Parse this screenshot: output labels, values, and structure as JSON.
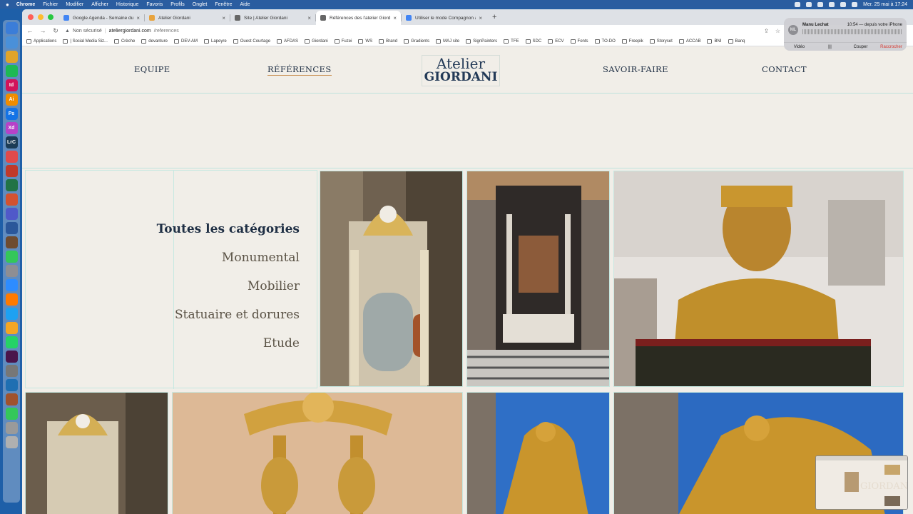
{
  "menubar": {
    "app": "Chrome",
    "menus": [
      "Fichier",
      "Modifier",
      "Afficher",
      "Historique",
      "Favoris",
      "Profils",
      "Onglet",
      "Fenêtre",
      "Aide"
    ],
    "clock": "Mer. 25 mai à 17:24"
  },
  "dock": {
    "apps": [
      {
        "label": "",
        "color": "#3b7dd8"
      },
      {
        "label": "",
        "color": "#4a90d9"
      },
      {
        "label": "",
        "color": "#e0a42a"
      },
      {
        "label": "",
        "color": "#1db954"
      },
      {
        "label": "Id",
        "color": "#d1145a"
      },
      {
        "label": "Ai",
        "color": "#f08c00"
      },
      {
        "label": "Ps",
        "color": "#1473e6"
      },
      {
        "label": "Xd",
        "color": "#b642c8"
      },
      {
        "label": "LrC",
        "color": "#1c3c56"
      },
      {
        "label": "",
        "color": "#e04a4a"
      },
      {
        "label": "",
        "color": "#c0392b"
      },
      {
        "label": "",
        "color": "#217346"
      },
      {
        "label": "",
        "color": "#d35230"
      },
      {
        "label": "",
        "color": "#5059c9"
      },
      {
        "label": "",
        "color": "#2b579a"
      },
      {
        "label": "",
        "color": "#6e4b2f"
      },
      {
        "label": "",
        "color": "#34c759"
      },
      {
        "label": "",
        "color": "#8e8e93"
      },
      {
        "label": "",
        "color": "#2d8cff"
      },
      {
        "label": "",
        "color": "#ff7a00"
      },
      {
        "label": "",
        "color": "#1da1f2"
      },
      {
        "label": "",
        "color": "#f5a623"
      },
      {
        "label": "",
        "color": "#25d366"
      },
      {
        "label": "",
        "color": "#4a154b"
      },
      {
        "label": "",
        "color": "#777777"
      },
      {
        "label": "",
        "color": "#1f6fb2"
      },
      {
        "label": "",
        "color": "#a0522d"
      },
      {
        "label": "",
        "color": "#34c759"
      },
      {
        "label": "",
        "color": "#9a9a9a"
      },
      {
        "label": "",
        "color": "#b0b0b0"
      }
    ]
  },
  "browser": {
    "tabs": [
      {
        "title": "Google Agenda - Semaine du",
        "favicon": "#4285f4",
        "active": false
      },
      {
        "title": "Atelier Giordani",
        "favicon": "#e8a33d",
        "active": false
      },
      {
        "title": "Site | Atelier Giordani",
        "favicon": "#666666",
        "active": false
      },
      {
        "title": "Références des l'atelier Giorda",
        "favicon": "#666666",
        "active": true
      },
      {
        "title": "Utiliser le mode Compagnon a",
        "favicon": "#4285f4",
        "active": false
      }
    ],
    "security_label": "Non sécurisé",
    "url_host": "ateliergiordani.com",
    "url_path": "/references",
    "bookmarks": [
      "Applications",
      "| Social Media Siz...",
      "Crèche",
      "devanture",
      "DEV-AM",
      "Lapeyre",
      "Ouest Courtage",
      "AFDAS",
      "Giordani",
      "Fuzei",
      "WS",
      "Brand",
      "Gradients",
      "MAJ site",
      "SignPainters",
      "TFE",
      "SDC",
      "ECV",
      "Fonts",
      "TO-DO",
      "Freepik",
      "Storyset",
      "ACCAB",
      "BNI",
      "Banq"
    ]
  },
  "site": {
    "nav": {
      "equipe": "EQUIPE",
      "references": "RÉFÉRENCES",
      "savoir_faire": "SAVOIR-FAIRE",
      "contact": "CONTACT"
    },
    "logo": {
      "line1": "Atelier",
      "line2": "GIORDANI"
    },
    "categories": [
      "Toutes les catégories",
      "Monumental",
      "Mobilier",
      "Statuaire et dorures",
      "Etude"
    ],
    "accent": "#1f2f44"
  },
  "notification": {
    "initials": "ML",
    "name": "Manu Lechat",
    "meta": "10:54 — depuis votre iPhone",
    "video": "Vidéo",
    "mute": "Couper",
    "end": "Raccrocher"
  },
  "thumbnail": {
    "watermark": "GIORDANI"
  }
}
